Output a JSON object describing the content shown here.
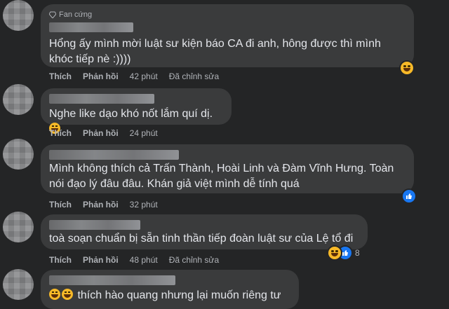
{
  "actions": {
    "like": "Thích",
    "reply": "Phản hồi",
    "edited": "Đã chỉnh sửa"
  },
  "comments": [
    {
      "badge": "Fan cứng",
      "text": "Hổng ấy mình mời luật sư kiện báo CA đi anh, hông được thì mình\nkhóc tiếp nè :))))",
      "time": "42 phút",
      "edited": true,
      "reaction": "haha",
      "reaction_count": ""
    },
    {
      "badge": "",
      "text": "Nghe like dạo khó nốt lắm quí dị.",
      "time": "24 phút",
      "edited": false,
      "reaction": "",
      "reaction_count": ""
    },
    {
      "badge": "",
      "text": "Mình không thích cả Trấn Thành, Hoài Linh và Đàm Vĩnh Hưng. Toàn\nnói đạo lý đâu đâu. Khán giả việt mình dễ tính quá",
      "time": "32 phút",
      "edited": false,
      "reaction": "like",
      "reaction_count": ""
    },
    {
      "badge": "",
      "text": "toà soạn chuẩn bị sẵn tinh thần tiếp đoàn luật sư của Lệ tổ đi",
      "time": "48 phút",
      "edited": true,
      "reaction": "haha,like",
      "reaction_count": "8"
    },
    {
      "badge": "",
      "text": "thích hào quang nhưng lại muốn riêng tư",
      "time": "",
      "edited": false,
      "reaction": "",
      "reaction_count": ""
    }
  ],
  "colors": {
    "background": "#242526",
    "bubble": "#3a3b3c",
    "text": "#e4e6eb",
    "meta": "#b0b3b8",
    "like_blue": "#1877f2",
    "haha_yellow": "#f7b928"
  },
  "icons": {
    "badge": "diamond-icon",
    "haha": "haha-reaction-icon",
    "like": "like-reaction-icon"
  }
}
